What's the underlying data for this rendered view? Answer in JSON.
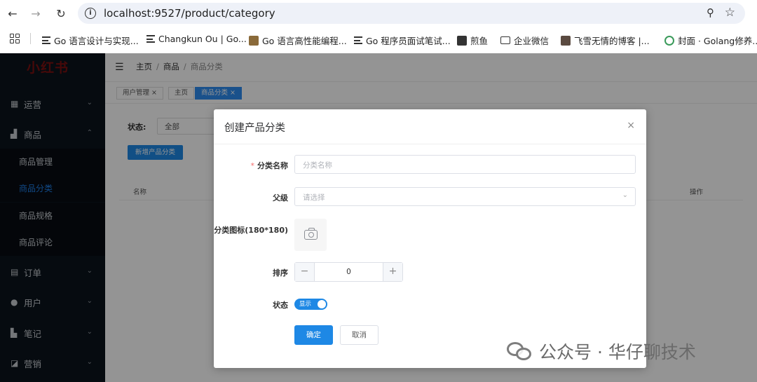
{
  "browser": {
    "url": "localhost:9527/product/category",
    "bookmarks": [
      {
        "label": "Go 语言设计与实现...",
        "icon": "lines-icon"
      },
      {
        "label": "Changkun Ou | Go...",
        "icon": "lines-icon"
      },
      {
        "label": "Go 语言高性能编程...",
        "icon": "image-icon"
      },
      {
        "label": "Go 程序员面试笔试...",
        "icon": "lines-icon"
      },
      {
        "label": "煎鱼",
        "icon": "image-icon"
      },
      {
        "label": "企业微信",
        "icon": "folder-icon"
      },
      {
        "label": "飞雪无情的博客 |...",
        "icon": "avatar-icon"
      },
      {
        "label": "封面 · Golang修养...",
        "icon": "leaf-icon"
      }
    ]
  },
  "sidebar": {
    "logo": "小红书",
    "menus": {
      "operations": "运营",
      "products": "商品",
      "orders": "订单",
      "users": "用户",
      "notes": "笔记",
      "marketing": "营销"
    },
    "product_items": {
      "manage": "商品管理",
      "category": "商品分类",
      "spec": "商品规格",
      "review": "商品评论"
    }
  },
  "header": {
    "breadcrumb": [
      "主页",
      "商品",
      "商品分类"
    ]
  },
  "tags": [
    "用户管理",
    "主页",
    "商品分类"
  ],
  "page": {
    "filter_label": "状态:",
    "filter_value": "全部",
    "new_button": "新增产品分类",
    "columns": {
      "name": "名称",
      "actions": "操作"
    }
  },
  "dialog": {
    "title": "创建产品分类",
    "close": "×",
    "fields": {
      "name_label": "分类名称",
      "name_placeholder": "分类名称",
      "parent_label": "父级",
      "parent_placeholder": "请选择",
      "icon_label": "分类图标(180*180)",
      "sort_label": "排序",
      "sort_value": "0",
      "status_label": "状态",
      "status_value": "显示"
    },
    "buttons": {
      "ok": "确定",
      "cancel": "取消"
    }
  },
  "watermark": "公众号 · 华仔聊技术",
  "colors": {
    "primary": "#1e88e5",
    "sidebar": "#0c141d",
    "required": "#f56c6c"
  }
}
